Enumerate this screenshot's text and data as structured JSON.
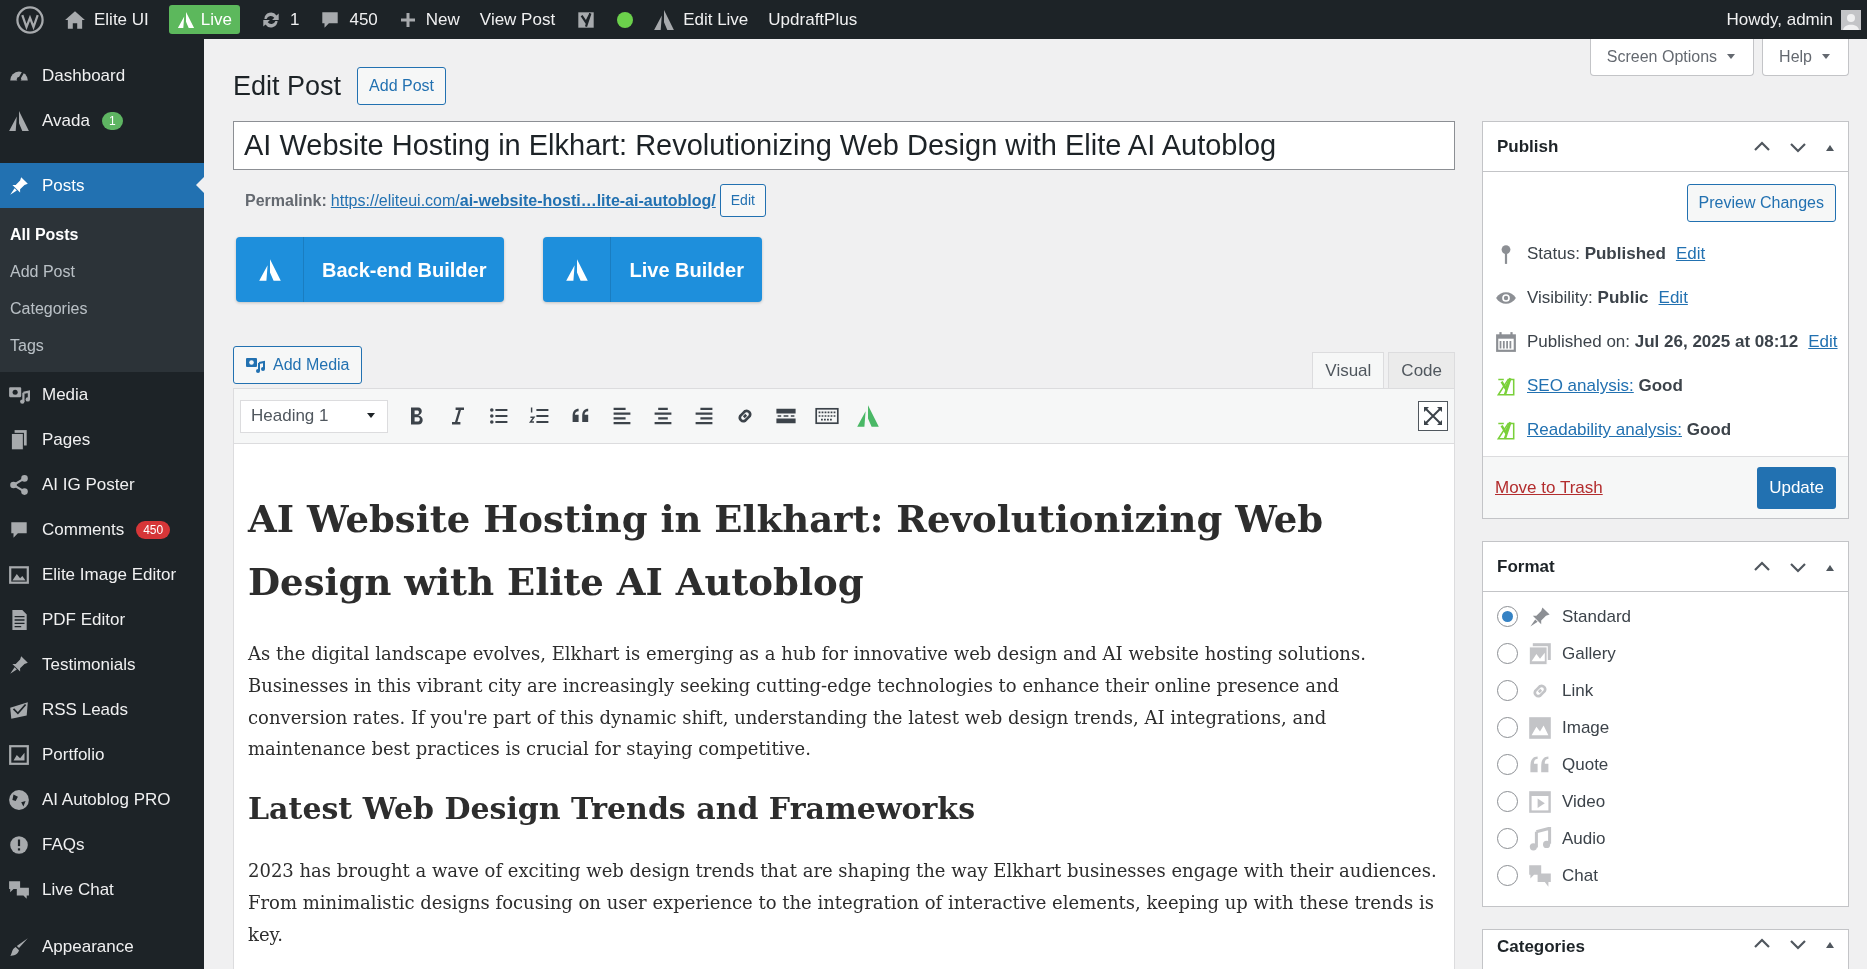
{
  "admin_bar": {
    "items": [
      {
        "kind": "logo"
      },
      {
        "kind": "site",
        "label": "Elite UI"
      },
      {
        "kind": "live",
        "label": "Live"
      },
      {
        "kind": "updates",
        "label": "1"
      },
      {
        "kind": "comments",
        "label": "450"
      },
      {
        "kind": "new",
        "label": "New"
      },
      {
        "kind": "link",
        "label": "View Post"
      },
      {
        "kind": "seo"
      },
      {
        "kind": "status",
        "color": "#6bd04b"
      },
      {
        "kind": "builder",
        "label": "Edit Live"
      },
      {
        "kind": "link",
        "label": "UpdraftPlus"
      }
    ],
    "greeting": "Howdy, admin"
  },
  "sidebar": {
    "groups": [
      [
        {
          "label": "Dashboard",
          "selected": false
        },
        {
          "label": "Avada",
          "selected": false,
          "badge": {
            "text": "1",
            "color": "#5eb562"
          }
        }
      ],
      [
        {
          "label": "Posts",
          "selected": true,
          "children": [
            {
              "label": "All Posts",
              "selected": true
            },
            {
              "label": "Add Post",
              "selected": false
            },
            {
              "label": "Categories",
              "selected": false
            },
            {
              "label": "Tags",
              "selected": false
            }
          ]
        },
        {
          "label": "Media",
          "selected": false
        },
        {
          "label": "Pages",
          "selected": false
        },
        {
          "label": "AI IG Poster",
          "selected": false
        },
        {
          "label": "Comments",
          "selected": false,
          "badge": {
            "text": "450",
            "color": "#d63638"
          }
        },
        {
          "label": "Elite Image Editor",
          "selected": false
        },
        {
          "label": "PDF Editor",
          "selected": false
        },
        {
          "label": "Testimonials",
          "selected": false
        },
        {
          "label": "RSS Leads",
          "selected": false
        },
        {
          "label": "Portfolio",
          "selected": false
        },
        {
          "label": "AI Autoblog PRO",
          "selected": false
        },
        {
          "label": "FAQs",
          "selected": false
        },
        {
          "label": "Live Chat",
          "selected": false
        }
      ],
      [
        {
          "label": "Appearance",
          "selected": false
        }
      ]
    ]
  },
  "screen_buttons": [
    "Screen Options",
    "Help"
  ],
  "page_title": "Edit Post",
  "add_button": "Add Post",
  "post_title": "AI Website Hosting in Elkhart: Revolutionizing Web Design with Elite AI Autoblog",
  "permalink": {
    "label": "Permalink:",
    "url": "https://eliteui.com/**ai-website-hosti…lite-ai-autoblog/**",
    "edit": "Edit"
  },
  "builders": [
    "Back-end Builder",
    "Live Builder"
  ],
  "editor": {
    "add_media": "Add Media",
    "tabs": [
      {
        "label": "Visual",
        "selected": true
      },
      {
        "label": "Code",
        "selected": false
      }
    ],
    "format_select": "Heading 1",
    "content": [
      {
        "kind": "h1",
        "text": "AI Website Hosting in Elkhart: Revolutionizing Web Design with Elite AI Autoblog"
      },
      {
        "kind": "p",
        "text": "As the digital landscape evolves, Elkhart is emerging as a hub for innovative web design and AI website hosting solutions. Businesses in this vibrant city are increasingly seeking cutting-edge technologies to enhance their online presence and conversion rates. If you're part of this dynamic shift, understanding the latest web design trends, AI integrations, and maintenance best practices is crucial for staying competitive."
      },
      {
        "kind": "h2",
        "text": "Latest Web Design Trends and Frameworks"
      },
      {
        "kind": "p",
        "text": "2023 has brought a wave of exciting web design trends that are shaping the way Elkhart businesses engage with their audiences. From minimalistic designs focusing on user experience to the integration of interactive elements, keeping up with these trends is key."
      }
    ]
  },
  "publish": {
    "title": "Publish",
    "preview": "Preview Changes",
    "rows": [
      {
        "kind": "setting",
        "label": "Status:",
        "value": "Published",
        "link": "Edit"
      },
      {
        "kind": "setting",
        "label": "Visibility:",
        "value": "Public",
        "link": "Edit"
      },
      {
        "kind": "setting",
        "label": "Published on:",
        "value": "Jul 26, 2025 at 08:12",
        "link": "Edit"
      },
      {
        "kind": "analysis",
        "link": "SEO analysis:",
        "value": "Good"
      },
      {
        "kind": "analysis",
        "link": "Readability analysis:",
        "value": "Good"
      }
    ],
    "trash": "Move to Trash",
    "update": "Update"
  },
  "format": {
    "title": "Format",
    "options": [
      {
        "label": "Standard",
        "selected": true
      },
      {
        "label": "Gallery",
        "selected": false
      },
      {
        "label": "Link",
        "selected": false
      },
      {
        "label": "Image",
        "selected": false
      },
      {
        "label": "Quote",
        "selected": false
      },
      {
        "label": "Video",
        "selected": false
      },
      {
        "label": "Audio",
        "selected": false
      },
      {
        "label": "Chat",
        "selected": false
      }
    ]
  },
  "categories": {
    "title": "Categories"
  }
}
